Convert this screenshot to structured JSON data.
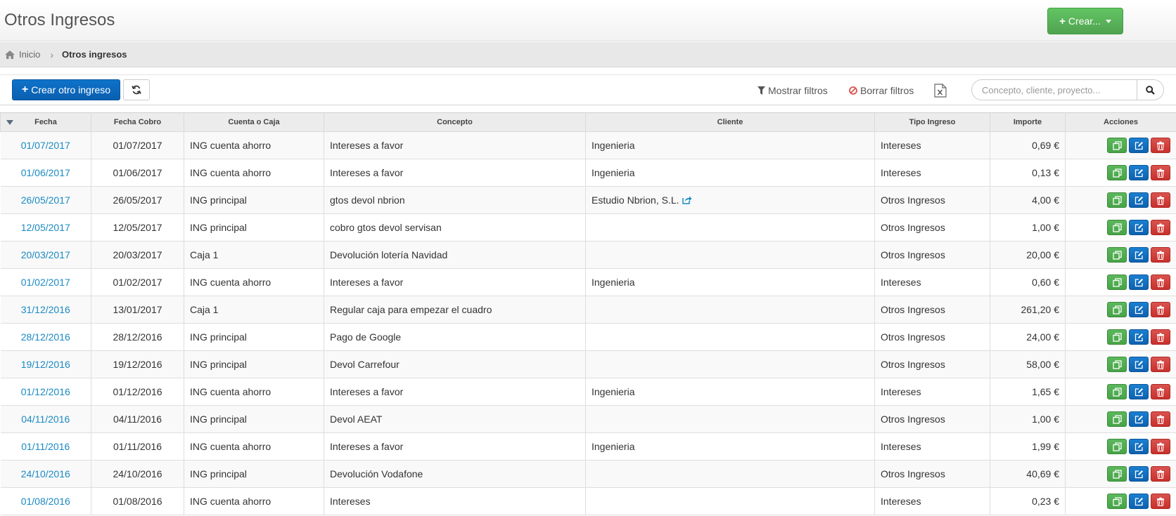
{
  "header": {
    "title": "Otros Ingresos",
    "create_label": "Crear..."
  },
  "breadcrumb": {
    "home": "Inicio",
    "current": "Otros ingresos"
  },
  "toolbar": {
    "create_label": "Crear otro ingreso",
    "show_filters": "Mostrar filtros",
    "clear_filters": "Borrar filtros",
    "search_placeholder": "Concepto, cliente, proyecto..."
  },
  "colors": {
    "primary": "#0e72c9",
    "success": "#51a351",
    "danger": "#d9534f",
    "link": "#1a8ac3"
  },
  "table": {
    "columns": [
      "Fecha",
      "Fecha Cobro",
      "Cuenta o Caja",
      "Concepto",
      "Cliente",
      "Tipo Ingreso",
      "Importe",
      "Acciones"
    ],
    "rows": [
      {
        "fecha": "01/07/2017",
        "cobro": "01/07/2017",
        "cuenta": "ING cuenta ahorro",
        "concepto": "Intereses a favor",
        "cliente": "Ingenieria",
        "tipo": "Intereses",
        "importe": "0,69 €"
      },
      {
        "fecha": "01/06/2017",
        "cobro": "01/06/2017",
        "cuenta": "ING cuenta ahorro",
        "concepto": "Intereses a favor",
        "cliente": "Ingenieria",
        "tipo": "Intereses",
        "importe": "0,13 €"
      },
      {
        "fecha": "26/05/2017",
        "cobro": "26/05/2017",
        "cuenta": "ING principal",
        "concepto": "gtos devol nbrion",
        "cliente": "Estudio Nbrion, S.L.",
        "tipo": "Otros Ingresos",
        "importe": "4,00 €"
      },
      {
        "fecha": "12/05/2017",
        "cobro": "12/05/2017",
        "cuenta": "ING principal",
        "concepto": "cobro gtos devol servisan",
        "cliente": "",
        "tipo": "Otros Ingresos",
        "importe": "1,00 €"
      },
      {
        "fecha": "20/03/2017",
        "cobro": "20/03/2017",
        "cuenta": "Caja 1",
        "concepto": "Devolución lotería Navidad",
        "cliente": "",
        "tipo": "Otros Ingresos",
        "importe": "20,00 €"
      },
      {
        "fecha": "01/02/2017",
        "cobro": "01/02/2017",
        "cuenta": "ING cuenta ahorro",
        "concepto": "Intereses a favor",
        "cliente": "Ingenieria",
        "tipo": "Intereses",
        "importe": "0,60 €"
      },
      {
        "fecha": "31/12/2016",
        "cobro": "13/01/2017",
        "cuenta": "Caja 1",
        "concepto": "Regular caja para empezar el cuadro",
        "cliente": "",
        "tipo": "Otros Ingresos",
        "importe": "261,20 €"
      },
      {
        "fecha": "28/12/2016",
        "cobro": "28/12/2016",
        "cuenta": "ING principal",
        "concepto": "Pago de Google",
        "cliente": "",
        "tipo": "Otros Ingresos",
        "importe": "24,00 €"
      },
      {
        "fecha": "19/12/2016",
        "cobro": "19/12/2016",
        "cuenta": "ING principal",
        "concepto": "Devol Carrefour",
        "cliente": "",
        "tipo": "Otros Ingresos",
        "importe": "58,00 €"
      },
      {
        "fecha": "01/12/2016",
        "cobro": "01/12/2016",
        "cuenta": "ING cuenta ahorro",
        "concepto": "Intereses a favor",
        "cliente": "Ingenieria",
        "tipo": "Intereses",
        "importe": "1,65 €"
      },
      {
        "fecha": "04/11/2016",
        "cobro": "04/11/2016",
        "cuenta": "ING principal",
        "concepto": "Devol AEAT",
        "cliente": "",
        "tipo": "Otros Ingresos",
        "importe": "1,00 €"
      },
      {
        "fecha": "01/11/2016",
        "cobro": "01/11/2016",
        "cuenta": "ING cuenta ahorro",
        "concepto": "Intereses a favor",
        "cliente": "Ingenieria",
        "tipo": "Intereses",
        "importe": "1,99 €"
      },
      {
        "fecha": "24/10/2016",
        "cobro": "24/10/2016",
        "cuenta": "ING principal",
        "concepto": "Devolución Vodafone",
        "cliente": "",
        "tipo": "Otros Ingresos",
        "importe": "40,69 €"
      },
      {
        "fecha": "01/08/2016",
        "cobro": "01/08/2016",
        "cuenta": "ING cuenta ahorro",
        "concepto": "Intereses",
        "cliente": "",
        "tipo": "Intereses",
        "importe": "0,23 €"
      }
    ]
  }
}
